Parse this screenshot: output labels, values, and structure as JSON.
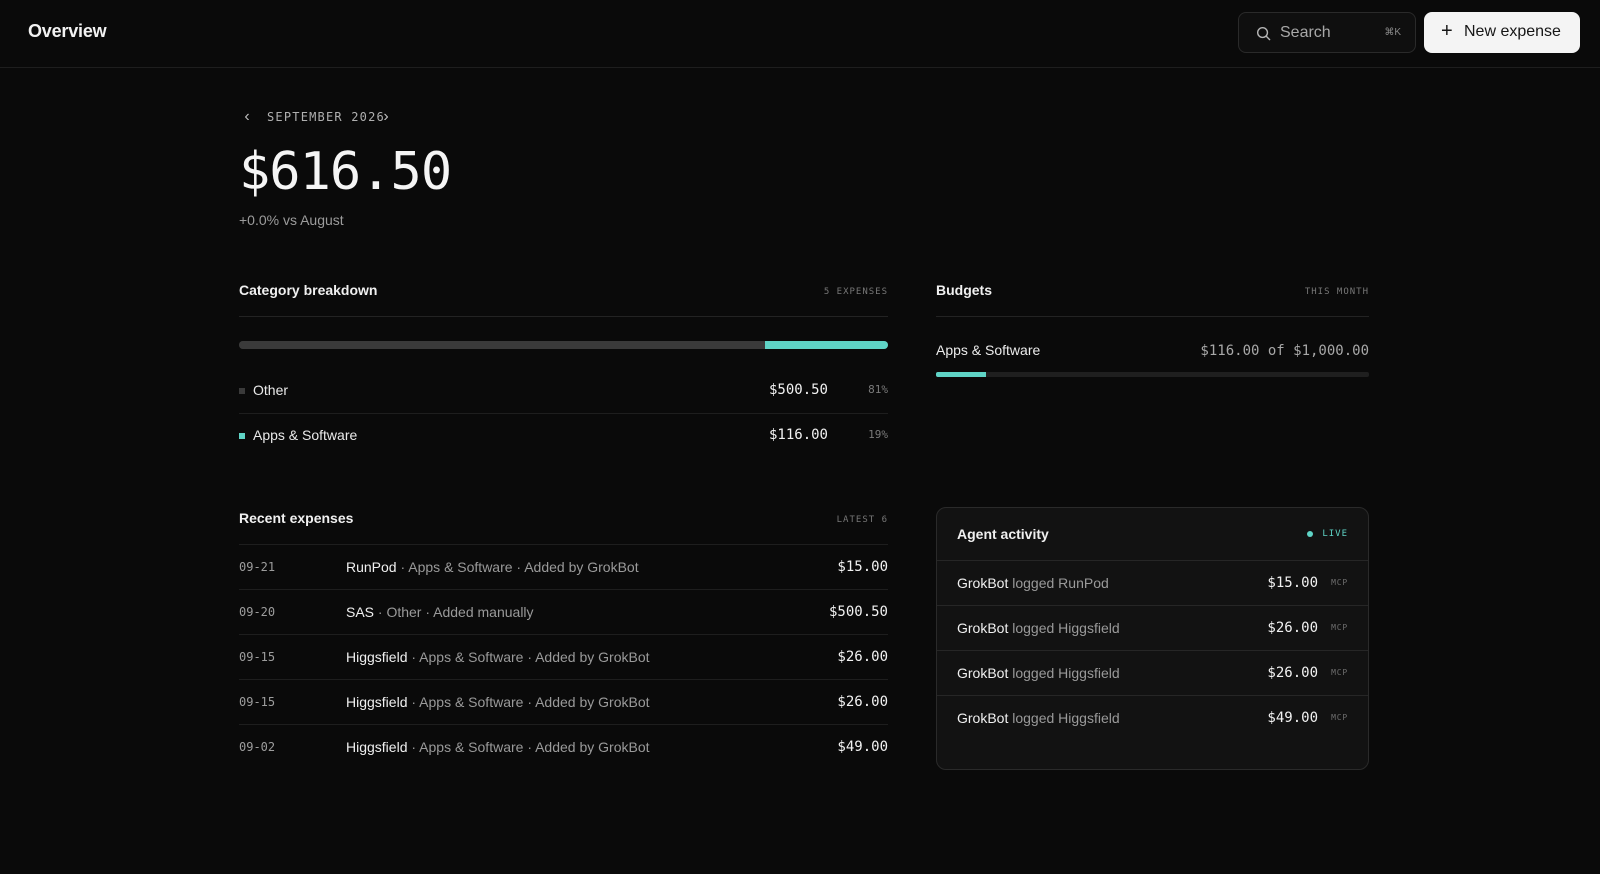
{
  "header": {
    "title": "Overview",
    "search_label": "Search",
    "search_shortcut": "⌘K",
    "new_expense_label": "New expense"
  },
  "period": {
    "month_label": "SEPTEMBER 2026",
    "total": "$616.50",
    "delta": "+0.0% vs August"
  },
  "category_breakdown": {
    "title": "Category breakdown",
    "meta": "5 EXPENSES",
    "items": [
      {
        "name": "Other",
        "amount": "$500.50",
        "percent": "81%",
        "fraction": 0.81,
        "color": "#3a3a3a"
      },
      {
        "name": "Apps & Software",
        "amount": "$116.00",
        "percent": "19%",
        "fraction": 0.19,
        "color": "#5fd4c6"
      }
    ]
  },
  "budgets": {
    "title": "Budgets",
    "meta": "THIS MONTH",
    "items": [
      {
        "name": "Apps & Software",
        "amount": "$116.00 of $1,000.00",
        "fraction": 0.116
      }
    ]
  },
  "recent_expenses": {
    "title": "Recent expenses",
    "meta": "LATEST 6",
    "rows": [
      {
        "date": "09-21",
        "vendor": "RunPod",
        "details": " · Apps & Software · Added by GrokBot",
        "amount": "$15.00"
      },
      {
        "date": "09-20",
        "vendor": "SAS",
        "details": " · Other · Added manually",
        "amount": "$500.50"
      },
      {
        "date": "09-15",
        "vendor": "Higgsfield",
        "details": " · Apps & Software · Added by GrokBot",
        "amount": "$26.00"
      },
      {
        "date": "09-15",
        "vendor": "Higgsfield",
        "details": " · Apps & Software · Added by GrokBot",
        "amount": "$26.00"
      },
      {
        "date": "09-02",
        "vendor": "Higgsfield",
        "details": " · Apps & Software · Added by GrokBot",
        "amount": "$49.00"
      }
    ]
  },
  "agent_activity": {
    "title": "Agent activity",
    "status": "LIVE",
    "rows": [
      {
        "agent": "GrokBot",
        "action": " logged RunPod",
        "amount": "$15.00",
        "source": "MCP"
      },
      {
        "agent": "GrokBot",
        "action": " logged Higgsfield",
        "amount": "$26.00",
        "source": "MCP"
      },
      {
        "agent": "GrokBot",
        "action": " logged Higgsfield",
        "amount": "$26.00",
        "source": "MCP"
      },
      {
        "agent": "GrokBot",
        "action": " logged Higgsfield",
        "amount": "$49.00",
        "source": "MCP"
      }
    ]
  },
  "colors": {
    "background": "#0a0a0a",
    "accent": "#5fd4c6",
    "neutral_segment": "#3a3a3a"
  }
}
